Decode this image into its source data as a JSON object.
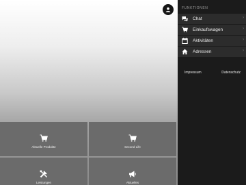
{
  "tiles": [
    {
      "label": "Aktuelle Produkte",
      "icon": "cart-icon"
    },
    {
      "label": "Second Life",
      "icon": "cart-icon"
    },
    {
      "label": "Leistungen",
      "icon": "tools-icon"
    },
    {
      "label": "Aktuelles",
      "icon": "megaphone-icon"
    }
  ],
  "sidebar": {
    "header": "FUNKTIONEN",
    "items": [
      {
        "label": "Chat",
        "icon": "chat-icon"
      },
      {
        "label": "Einkaufswagen",
        "icon": "cart-icon"
      },
      {
        "label": "Aktivitäten",
        "icon": "calendar-icon"
      },
      {
        "label": "Adressen",
        "icon": "home-icon"
      }
    ],
    "footer": {
      "impressum": "Impressum",
      "datenschutz": "Datenschutz"
    }
  },
  "colors": {
    "sidebar_bg": "#1b1b1b",
    "menu_item_bg": "#2c2c2c",
    "tile_bg": "#6b6b6b",
    "icon": "#ffffff"
  }
}
